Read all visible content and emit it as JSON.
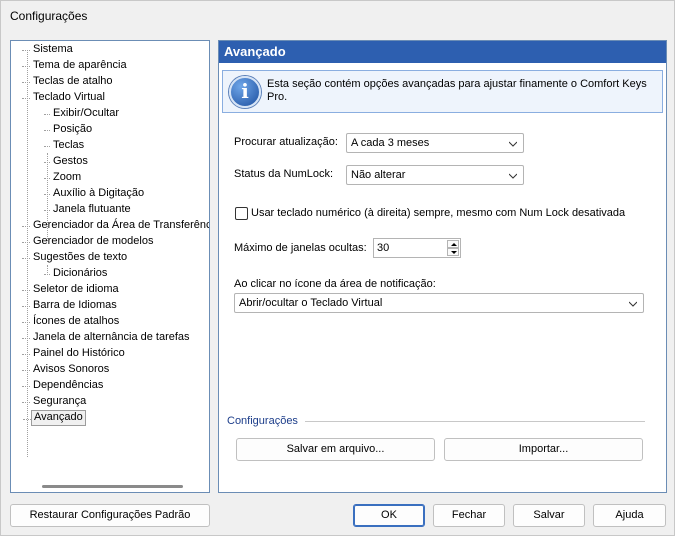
{
  "window": {
    "title": "Configurações"
  },
  "tree": {
    "items": [
      {
        "label": "Sistema",
        "level": 1
      },
      {
        "label": "Tema de aparência",
        "level": 1
      },
      {
        "label": "Teclas de atalho",
        "level": 1
      },
      {
        "label": "Teclado Virtual",
        "level": 1
      },
      {
        "label": "Exibir/Ocultar",
        "level": 2
      },
      {
        "label": "Posição",
        "level": 2
      },
      {
        "label": "Teclas",
        "level": 2
      },
      {
        "label": "Gestos",
        "level": 2
      },
      {
        "label": "Zoom",
        "level": 2
      },
      {
        "label": "Auxílio à Digitação",
        "level": 2
      },
      {
        "label": "Janela flutuante",
        "level": 2
      },
      {
        "label": "Gerenciador da Área de Transferência",
        "level": 1
      },
      {
        "label": "Gerenciador de modelos",
        "level": 1
      },
      {
        "label": "Sugestões de texto",
        "level": 1
      },
      {
        "label": "Dicionários",
        "level": 2
      },
      {
        "label": "Seletor de idioma",
        "level": 1
      },
      {
        "label": "Barra de Idiomas",
        "level": 1
      },
      {
        "label": "Ícones de atalhos",
        "level": 1
      },
      {
        "label": "Janela de alternância de tarefas",
        "level": 1
      },
      {
        "label": "Painel do Histórico",
        "level": 1
      },
      {
        "label": "Avisos Sonoros",
        "level": 1
      },
      {
        "label": "Dependências",
        "level": 1
      },
      {
        "label": "Segurança",
        "level": 1
      },
      {
        "label": "Avançado",
        "level": 1,
        "selected": true
      }
    ]
  },
  "panel": {
    "title": "Avançado",
    "info": "Esta seção contém opções avançadas para ajustar finamente o Comfort Keys Pro.",
    "update_label": "Procurar atualização:",
    "update_value": "A cada 3 meses",
    "numlock_label": "Status da NumLock:",
    "numlock_value": "Não alterar",
    "numpad_checkbox_label": "Usar teclado numérico (à direita) sempre, mesmo com Num Lock desativada",
    "numpad_checked": false,
    "max_windows_label": "Máximo de janelas ocultas:",
    "max_windows_value": "30",
    "tray_click_label": "Ao clicar no ícone da área de notificação:",
    "tray_click_value": "Abrir/ocultar o Teclado Virtual",
    "group_title": "Configurações",
    "save_file_button": "Salvar em arquivo...",
    "import_button": "Importar..."
  },
  "footer": {
    "restore_button": "Restaurar Configurações Padrão",
    "ok_button": "OK",
    "close_button": "Fechar",
    "save_button": "Salvar",
    "help_button": "Ajuda"
  },
  "colors": {
    "header_bg": "#2d5fb0",
    "border_accent": "#6b8db5",
    "info_bg": "#eef4fc"
  }
}
